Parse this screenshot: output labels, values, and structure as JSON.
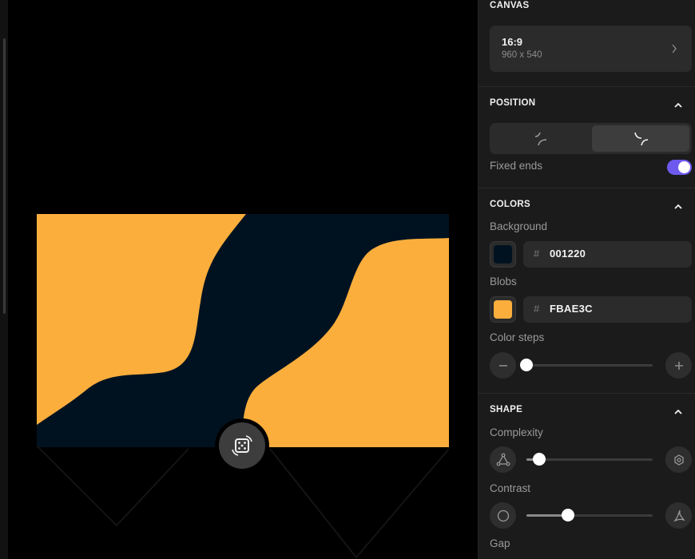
{
  "canvas_section": {
    "title": "CANVAS",
    "ratio_title": "16:9",
    "ratio_size": "960 x 540"
  },
  "position_section": {
    "title": "POSITION",
    "fixed_ends_label": "Fixed ends",
    "fixed_ends_on": true,
    "selected_option": 2
  },
  "colors_section": {
    "title": "COLORS",
    "background_label": "Background",
    "background_hash": "#",
    "background_hex": "001220",
    "background_color": "#001220",
    "blobs_label": "Blobs",
    "blobs_hash": "#",
    "blobs_hex": "FBAE3C",
    "blobs_color": "#FBAE3C",
    "color_steps_label": "Color steps",
    "color_steps_level": 0
  },
  "shape_section": {
    "title": "SHAPE",
    "complexity_label": "Complexity",
    "complexity_level": 0.1,
    "contrast_label": "Contrast",
    "contrast_level": 0.33,
    "gap_label": "Gap"
  },
  "colors": {
    "accent": "#6E59EF",
    "background": "#001220",
    "blob": "#FBAE3C"
  },
  "icons": {
    "randomize": "dice-icon",
    "chevron": "chevron-right-icon",
    "collapse": "chevron-up-icon"
  }
}
